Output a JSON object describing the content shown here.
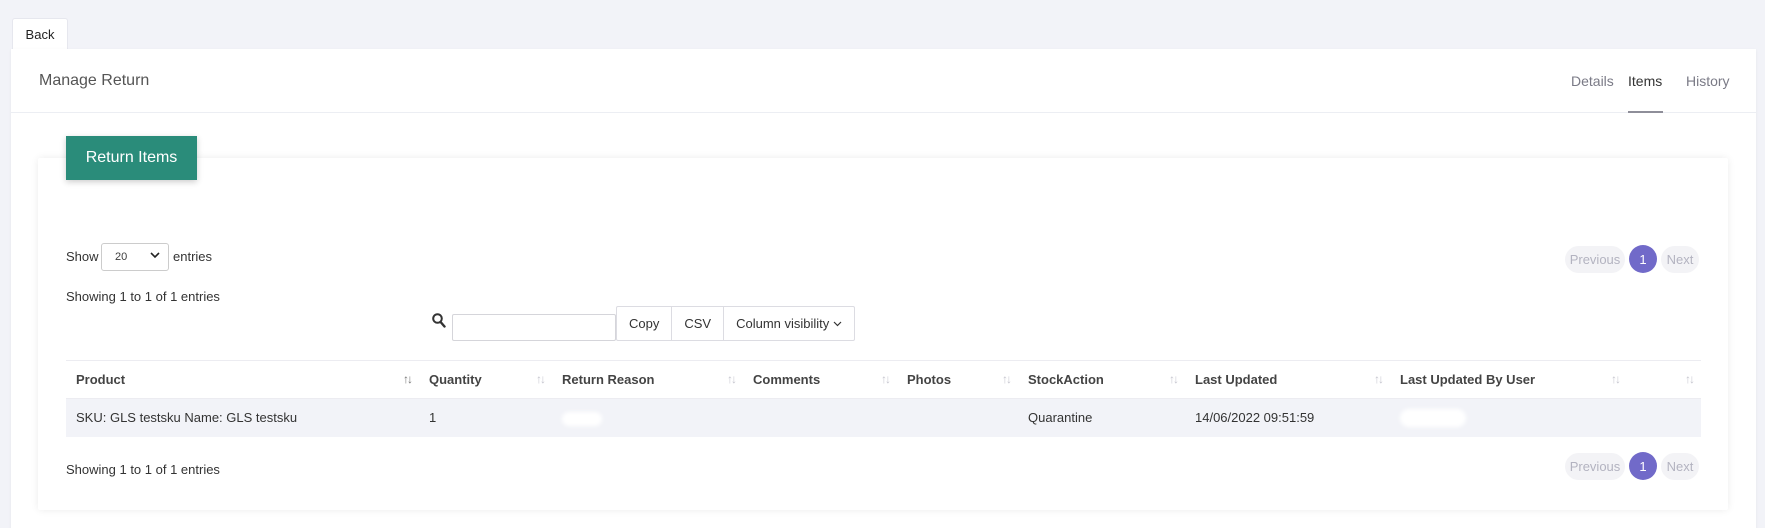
{
  "back_label": "Back",
  "header": {
    "title": "Manage Return",
    "tabs": [
      {
        "label": "Details",
        "active": false
      },
      {
        "label": "Items",
        "active": true
      },
      {
        "label": "History",
        "active": false
      }
    ]
  },
  "panel": {
    "title_button": "Return Items",
    "length": {
      "prefix": "Show",
      "value": "20",
      "suffix": "entries"
    },
    "info_top": "Showing 1 to 1 of 1 entries",
    "info_bottom": "Showing 1 to 1 of 1 entries",
    "pagination": {
      "previous": "Previous",
      "current": "1",
      "next": "Next"
    },
    "search": {
      "value": "",
      "placeholder": ""
    },
    "buttons": {
      "copy": "Copy",
      "csv": "CSV",
      "column_visibility": "Column visibility"
    },
    "table": {
      "columns": [
        "Product",
        "Quantity",
        "Return Reason",
        "Comments",
        "Photos",
        "StockAction",
        "Last Updated",
        "Last Updated By User",
        ""
      ],
      "rows": [
        {
          "product": "SKU: GLS testsku Name: GLS testsku",
          "quantity": "1",
          "return_reason": "",
          "comments": "",
          "photos": "",
          "stock_action": "Quarantine",
          "last_updated": "14/06/2022 09:51:59",
          "last_updated_by": "",
          "extra": ""
        }
      ]
    }
  },
  "colors": {
    "accent_green": "#2a8c7a",
    "pagination_active": "#716ac9",
    "row_bg": "#f2f3f8"
  }
}
